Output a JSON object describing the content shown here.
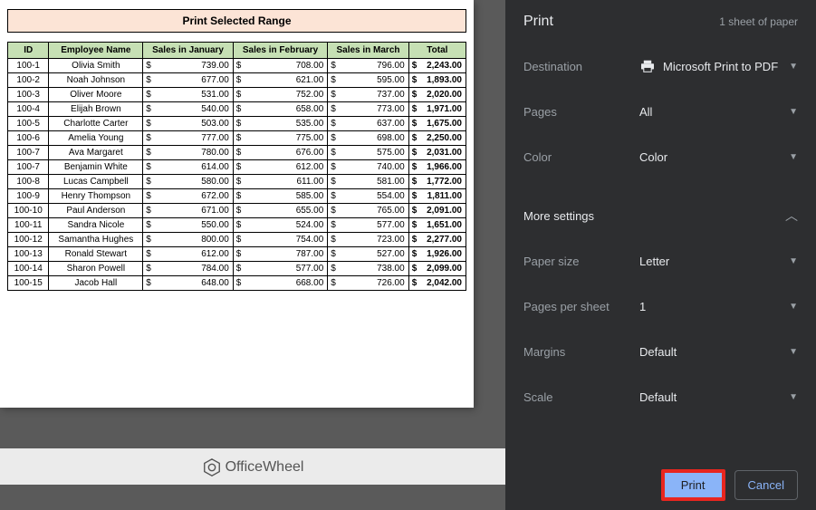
{
  "paper": {
    "title": "Print Selected Range",
    "headers": [
      "ID",
      "Employee Name",
      "Sales in January",
      "Sales in February",
      "Sales in March",
      "Total"
    ],
    "rows": [
      {
        "id": "100-1",
        "name": "Olivia Smith",
        "jan": "739.00",
        "feb": "708.00",
        "mar": "796.00",
        "total": "2,243.00"
      },
      {
        "id": "100-2",
        "name": "Noah Johnson",
        "jan": "677.00",
        "feb": "621.00",
        "mar": "595.00",
        "total": "1,893.00"
      },
      {
        "id": "100-3",
        "name": "Oliver Moore",
        "jan": "531.00",
        "feb": "752.00",
        "mar": "737.00",
        "total": "2,020.00"
      },
      {
        "id": "100-4",
        "name": "Elijah Brown",
        "jan": "540.00",
        "feb": "658.00",
        "mar": "773.00",
        "total": "1,971.00"
      },
      {
        "id": "100-5",
        "name": "Charlotte Carter",
        "jan": "503.00",
        "feb": "535.00",
        "mar": "637.00",
        "total": "1,675.00"
      },
      {
        "id": "100-6",
        "name": "Amelia Young",
        "jan": "777.00",
        "feb": "775.00",
        "mar": "698.00",
        "total": "2,250.00"
      },
      {
        "id": "100-7",
        "name": "Ava Margaret",
        "jan": "780.00",
        "feb": "676.00",
        "mar": "575.00",
        "total": "2,031.00"
      },
      {
        "id": "100-7",
        "name": "Benjamin White",
        "jan": "614.00",
        "feb": "612.00",
        "mar": "740.00",
        "total": "1,966.00"
      },
      {
        "id": "100-8",
        "name": "Lucas Campbell",
        "jan": "580.00",
        "feb": "611.00",
        "mar": "581.00",
        "total": "1,772.00"
      },
      {
        "id": "100-9",
        "name": "Henry Thompson",
        "jan": "672.00",
        "feb": "585.00",
        "mar": "554.00",
        "total": "1,811.00"
      },
      {
        "id": "100-10",
        "name": "Paul Anderson",
        "jan": "671.00",
        "feb": "655.00",
        "mar": "765.00",
        "total": "2,091.00"
      },
      {
        "id": "100-11",
        "name": "Sandra Nicole",
        "jan": "550.00",
        "feb": "524.00",
        "mar": "577.00",
        "total": "1,651.00"
      },
      {
        "id": "100-12",
        "name": "Samantha Hughes",
        "jan": "800.00",
        "feb": "754.00",
        "mar": "723.00",
        "total": "2,277.00"
      },
      {
        "id": "100-13",
        "name": "Ronald Stewart",
        "jan": "612.00",
        "feb": "787.00",
        "mar": "527.00",
        "total": "1,926.00"
      },
      {
        "id": "100-14",
        "name": "Sharon Powell",
        "jan": "784.00",
        "feb": "577.00",
        "mar": "738.00",
        "total": "2,099.00"
      },
      {
        "id": "100-15",
        "name": "Jacob Hall",
        "jan": "648.00",
        "feb": "668.00",
        "mar": "726.00",
        "total": "2,042.00"
      }
    ]
  },
  "logo": {
    "text": "OfficeWheel"
  },
  "panel": {
    "title": "Print",
    "sheet_count": "1 sheet of paper",
    "settings": {
      "destination": {
        "label": "Destination",
        "value": "Microsoft Print to PDF"
      },
      "pages": {
        "label": "Pages",
        "value": "All"
      },
      "color": {
        "label": "Color",
        "value": "Color"
      },
      "more": {
        "label": "More settings"
      },
      "paper_size": {
        "label": "Paper size",
        "value": "Letter"
      },
      "pages_per_sheet": {
        "label": "Pages per sheet",
        "value": "1"
      },
      "margins": {
        "label": "Margins",
        "value": "Default"
      },
      "scale": {
        "label": "Scale",
        "value": "Default"
      }
    },
    "buttons": {
      "print": "Print",
      "cancel": "Cancel"
    }
  }
}
